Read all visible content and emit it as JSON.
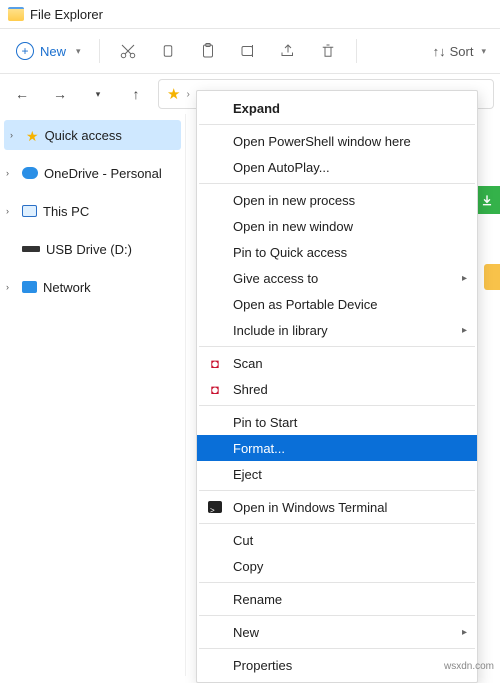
{
  "window": {
    "title": "File Explorer"
  },
  "toolbar": {
    "new_label": "New",
    "sort_label": "Sort"
  },
  "sidebar": {
    "items": [
      {
        "label": "Quick access"
      },
      {
        "label": "OneDrive - Personal"
      },
      {
        "label": "This PC"
      },
      {
        "label": "USB Drive (D:)"
      },
      {
        "label": "Network"
      }
    ]
  },
  "context_menu": {
    "expand": "Expand",
    "open_powershell": "Open PowerShell window here",
    "open_autoplay": "Open AutoPlay...",
    "open_new_process": "Open in new process",
    "open_new_window": "Open in new window",
    "pin_quick_access": "Pin to Quick access",
    "give_access": "Give access to",
    "open_portable": "Open as Portable Device",
    "include_library": "Include in library",
    "scan": "Scan",
    "shred": "Shred",
    "pin_start": "Pin to Start",
    "format": "Format...",
    "eject": "Eject",
    "open_terminal": "Open in Windows Terminal",
    "cut": "Cut",
    "copy": "Copy",
    "rename": "Rename",
    "new": "New",
    "properties": "Properties"
  },
  "watermark": "wsxdn.com"
}
